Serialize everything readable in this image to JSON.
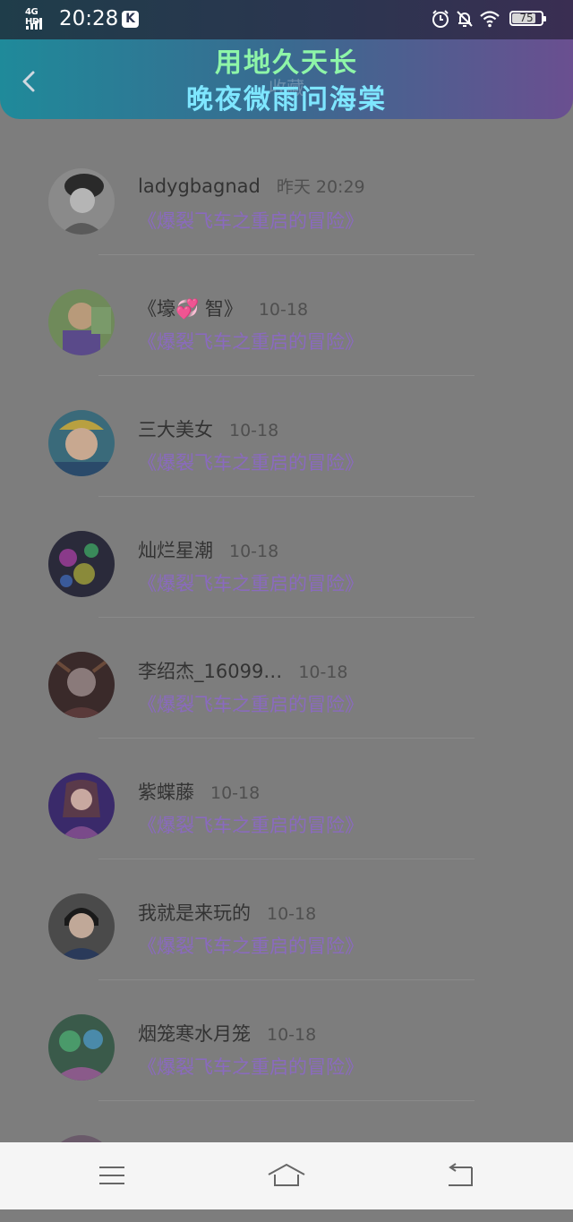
{
  "status_bar": {
    "network": "4G HD",
    "time": "20:28",
    "app_badge": "K",
    "battery": "75"
  },
  "header": {
    "banner_line1": "用地久天长",
    "banner_line2": "晚夜微雨问海棠",
    "title": "收藏"
  },
  "list": [
    {
      "name": "ladygbagnad",
      "time": "昨天 20:29",
      "book": "《爆裂飞车之重启的冒险》"
    },
    {
      "name": "《壕💞 智》",
      "time": "10-18",
      "book": "《爆裂飞车之重启的冒险》"
    },
    {
      "name": "三大美女",
      "time": "10-18",
      "book": "《爆裂飞车之重启的冒险》"
    },
    {
      "name": "灿烂星潮",
      "time": "10-18",
      "book": "《爆裂飞车之重启的冒险》"
    },
    {
      "name": "李绍杰_16099…",
      "time": "10-18",
      "book": "《爆裂飞车之重启的冒险》"
    },
    {
      "name": "紫蝶藤",
      "time": "10-18",
      "book": "《爆裂飞车之重启的冒险》"
    },
    {
      "name": "我就是来玩的",
      "time": "10-18",
      "book": "《爆裂飞车之重启的冒险》"
    },
    {
      "name": "烟笼寒水月笼",
      "time": "10-18",
      "book": "《爆裂飞车之重启的冒险》"
    }
  ],
  "nav": {
    "menu_icon": "menu-icon",
    "home_icon": "home-icon",
    "back_icon": "return-icon"
  },
  "colors": {
    "overlay": "#7d7d7d",
    "book_link": "#8a6abf",
    "banner_green": "#8ef5a8",
    "banner_cyan": "#7ee6ff"
  }
}
